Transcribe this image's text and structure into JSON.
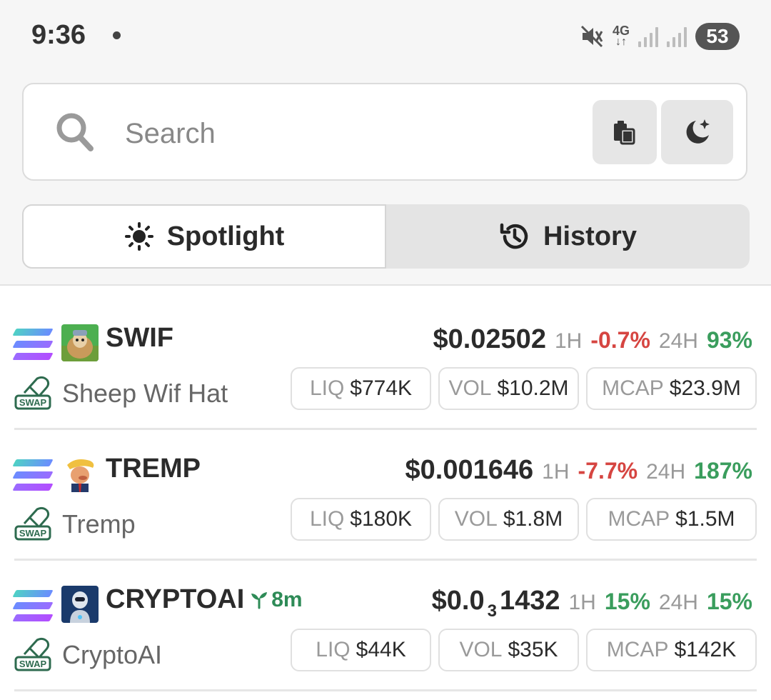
{
  "status_bar": {
    "time": "9:36",
    "network": "4G",
    "battery": "53"
  },
  "search": {
    "placeholder": "Search"
  },
  "tabs": [
    {
      "label": "Spotlight",
      "icon": "sun-icon",
      "active": true
    },
    {
      "label": "History",
      "icon": "history-icon",
      "active": false
    }
  ],
  "tokens": [
    {
      "symbol": "SWIF",
      "name": "Sheep Wif Hat",
      "price": "$0.02502",
      "h1_label": "1H",
      "h1_change": "-0.7%",
      "h1_dir": "neg",
      "h24_label": "24H",
      "h24_change": "93%",
      "h24_dir": "pos",
      "liq_label": "LIQ",
      "liq": "$774K",
      "vol_label": "VOL",
      "vol": "$10.2M",
      "mcap_label": "MCAP",
      "mcap": "$23.9M"
    },
    {
      "symbol": "TREMP",
      "name": "Tremp",
      "price": "$0.001646",
      "h1_label": "1H",
      "h1_change": "-7.7%",
      "h1_dir": "neg",
      "h24_label": "24H",
      "h24_change": "187%",
      "h24_dir": "pos",
      "liq_label": "LIQ",
      "liq": "$180K",
      "vol_label": "VOL",
      "vol": "$1.8M",
      "mcap_label": "MCAP",
      "mcap": "$1.5M"
    },
    {
      "symbol": "CRYPTOAI",
      "name": "CryptoAI",
      "age": "8m",
      "price_prefix": "$0.0",
      "price_zeros": "3",
      "price_suffix": "1432",
      "h1_label": "1H",
      "h1_change": "15%",
      "h1_dir": "pos",
      "h24_label": "24H",
      "h24_change": "15%",
      "h24_dir": "pos",
      "liq_label": "LIQ",
      "liq": "$44K",
      "vol_label": "VOL",
      "vol": "$35K",
      "mcap_label": "MCAP",
      "mcap": "$142K"
    }
  ],
  "colors": {
    "negative": "#d64541",
    "positive": "#3a9d5d",
    "chain_gradient": [
      "#4fd1c5",
      "#6b8cff",
      "#b34dff"
    ]
  }
}
